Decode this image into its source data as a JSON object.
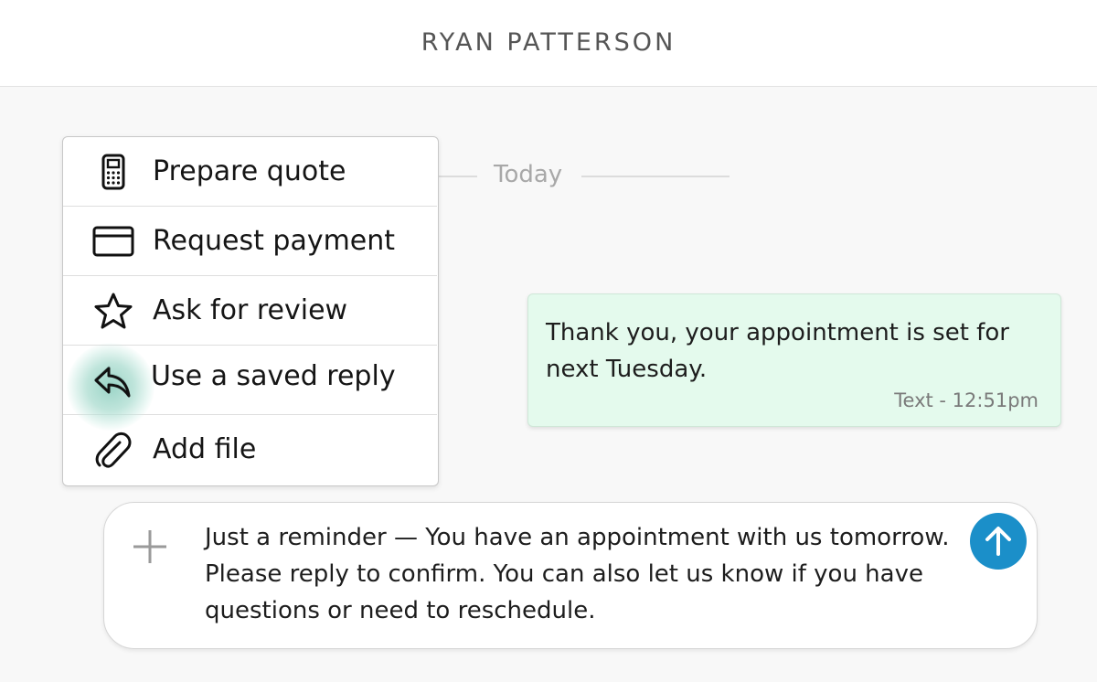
{
  "header": {
    "contact_name": "RYAN PATTERSON"
  },
  "date_divider": {
    "label": "Today"
  },
  "actions_menu": {
    "items": [
      {
        "label": "Prepare quote",
        "icon": "calculator-icon"
      },
      {
        "label": "Request payment",
        "icon": "credit-card-icon"
      },
      {
        "label": "Ask for review",
        "icon": "star-icon"
      },
      {
        "label": "Use a saved reply",
        "icon": "reply-icon",
        "highlighted": true
      },
      {
        "label": "Add file",
        "icon": "paperclip-icon"
      }
    ]
  },
  "messages": [
    {
      "text": "Thank you, your appointment is set for next Tuesday.",
      "meta": "Text - 12:51pm",
      "direction": "outgoing"
    }
  ],
  "composer": {
    "text": "Just a reminder — You have an appointment with us tomorrow. Please reply to confirm. You can also let us know if you have questions or need to reschedule.",
    "add_icon": "plus-icon",
    "send_icon": "arrow-up-icon"
  },
  "colors": {
    "outgoing_bubble": "#e4faed",
    "send_button": "#1b8fc9",
    "highlight_ripple": "#96d2c4",
    "background": "#f8f8f8"
  }
}
